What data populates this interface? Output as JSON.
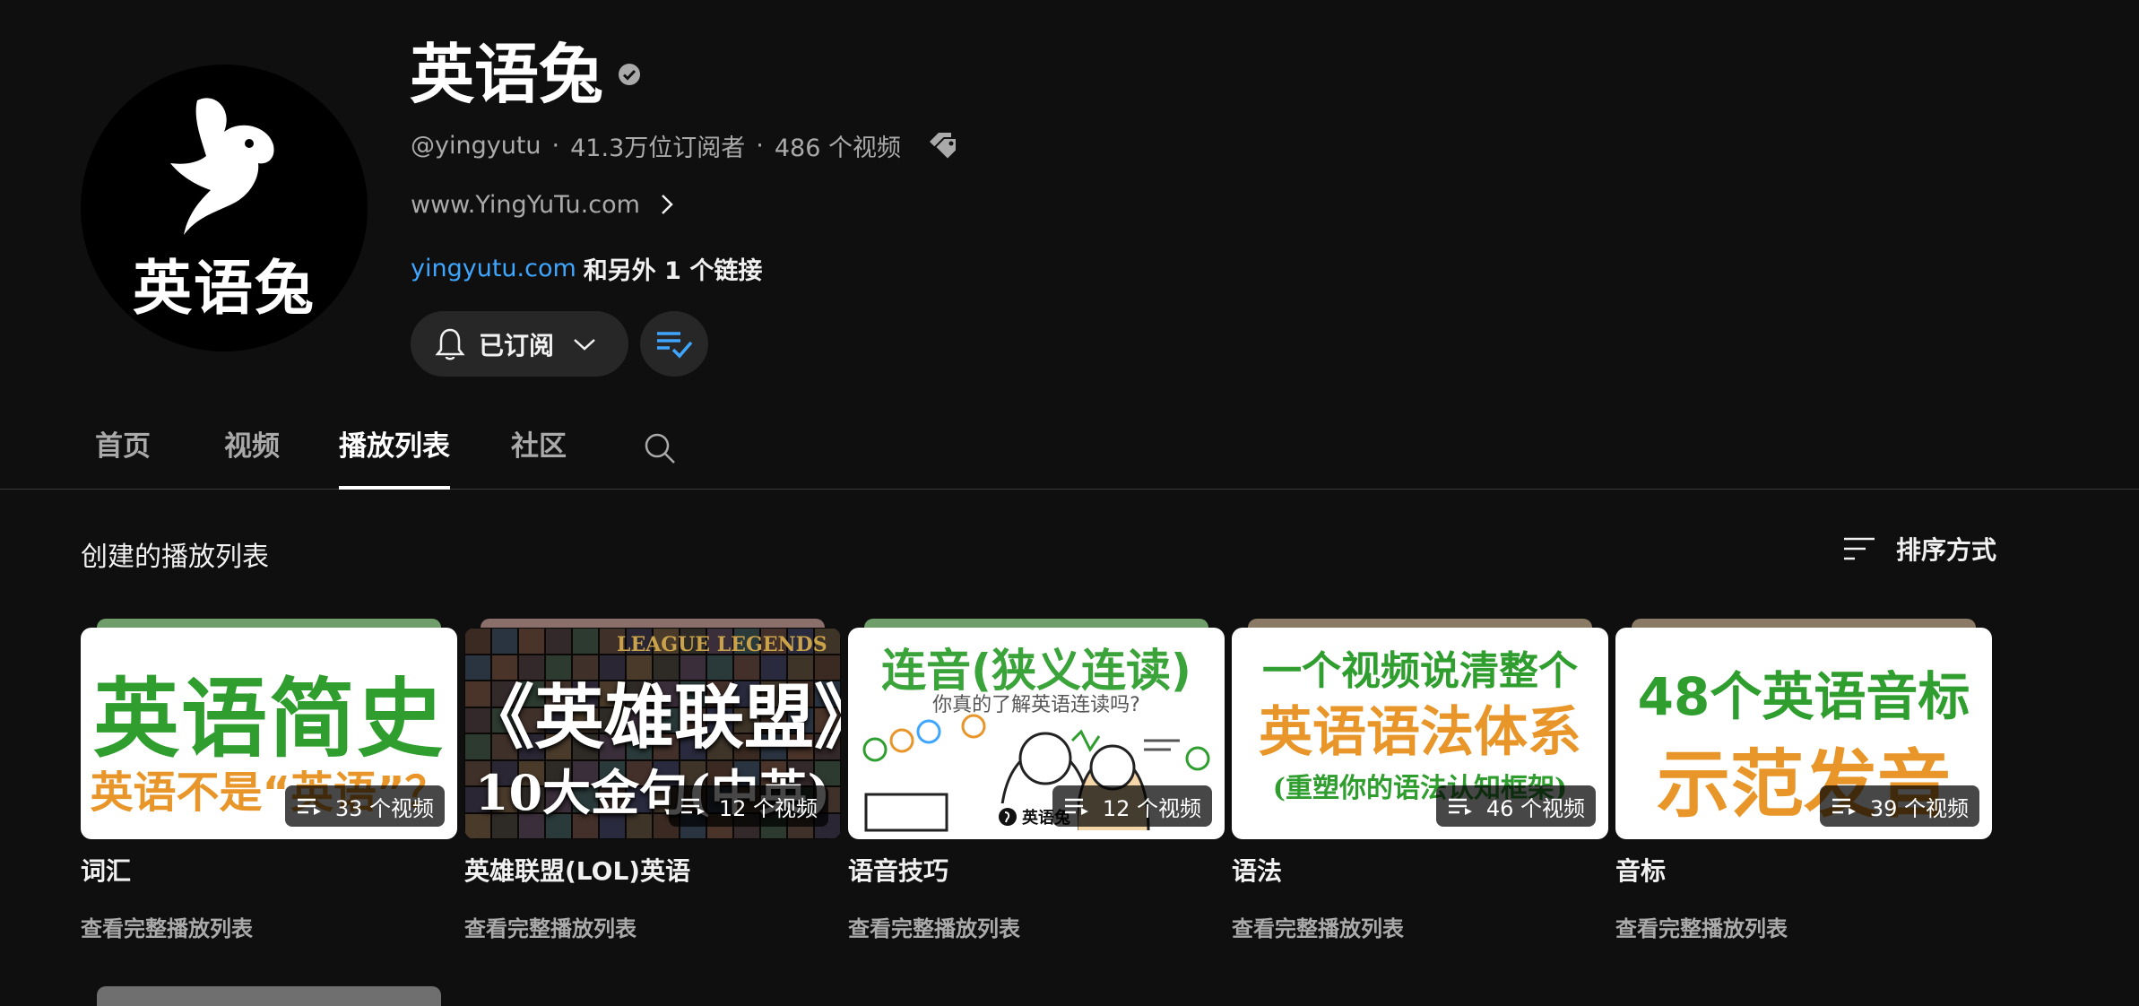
{
  "channel": {
    "name": "英语兔",
    "avatar_text": "英语兔",
    "handle": "@yingyutu",
    "subscribers": "41.3万位订阅者",
    "video_count": "486 个视频",
    "separator": "·",
    "website": "www.YingYuTu.com",
    "link": "yingyutu.com",
    "more_links": "和另外 1 个链接",
    "subscribe_label": "已订阅"
  },
  "tabs": [
    {
      "label": "首页"
    },
    {
      "label": "视频"
    },
    {
      "label": "播放列表",
      "active": true
    },
    {
      "label": "社区"
    }
  ],
  "section": {
    "title": "创建的播放列表",
    "sort_label": "排序方式"
  },
  "playlists": [
    {
      "title": "词汇",
      "count": "33 个视频",
      "link": "查看完整播放列表",
      "thumb_lines": [
        "英语简史",
        "英语不是“英语”？"
      ]
    },
    {
      "title": "英雄联盟(LOL)英语",
      "count": "12 个视频",
      "link": "查看完整播放列表",
      "thumb_lines": [
        "LEAGUE LEGENDS",
        "《英雄联盟》",
        "10大金句(中英)"
      ]
    },
    {
      "title": "语音技巧",
      "count": "12 个视频",
      "link": "查看完整播放列表",
      "thumb_lines": [
        "连音(狭义连读)",
        "你真的了解英语连读吗?",
        "英语兔"
      ]
    },
    {
      "title": "语法",
      "count": "46 个视频",
      "link": "查看完整播放列表",
      "thumb_lines": [
        "一个视频说清整个",
        "英语语法体系",
        "(重塑你的语法认知框架)"
      ]
    },
    {
      "title": "音标",
      "count": "39 个视频",
      "link": "查看完整播放列表",
      "thumb_lines": [
        "48个英语音标",
        "示范发音"
      ]
    }
  ],
  "colors": {
    "background": "#0f0f0f",
    "link": "#3ea6ff",
    "green": "#2f9e2f",
    "orange": "#e8962a"
  }
}
